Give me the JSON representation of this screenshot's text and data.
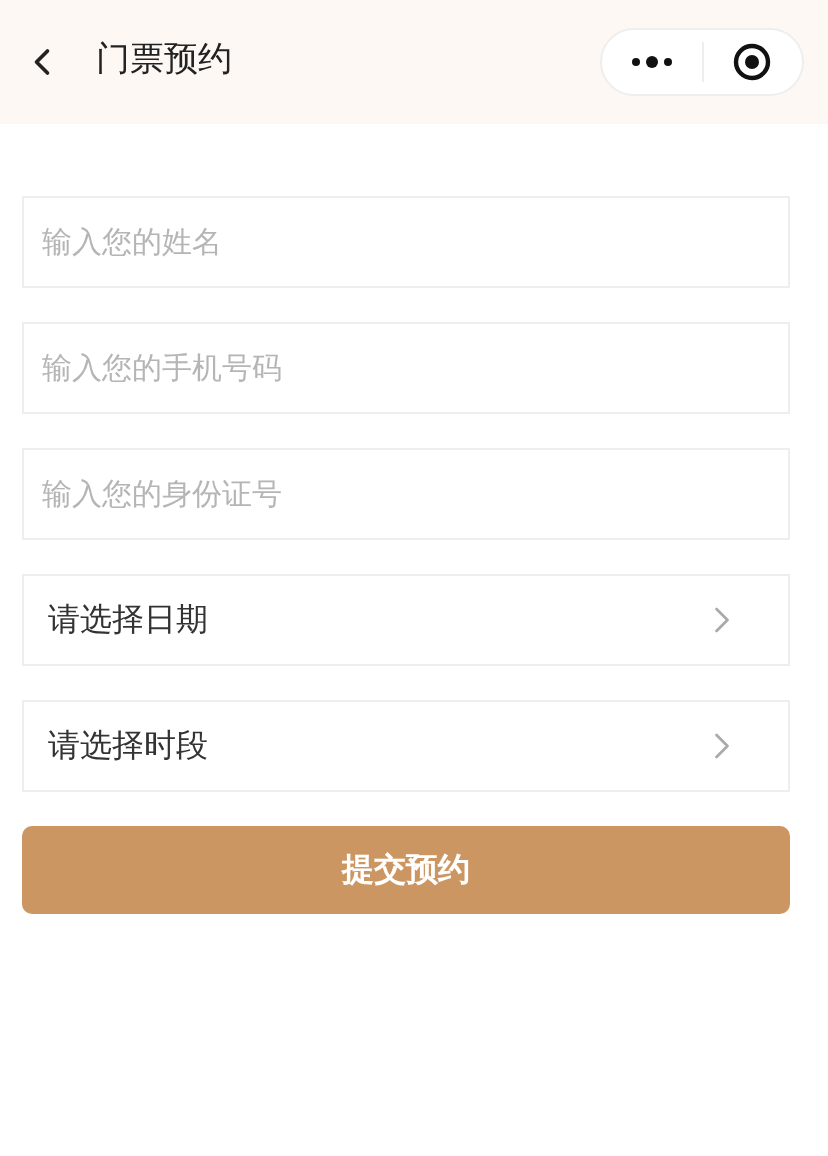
{
  "nav_bar": {
    "title": "门票预约"
  },
  "fields": [
    {
      "kind": "input",
      "placeholder": "输入您的姓名"
    },
    {
      "kind": "input",
      "placeholder": "输入您的手机号码"
    },
    {
      "kind": "input",
      "placeholder": "输入您的身份证号"
    },
    {
      "kind": "select",
      "label": "请选择日期"
    },
    {
      "kind": "select",
      "label": "请选择时段"
    }
  ],
  "submit_button": "提交预约"
}
